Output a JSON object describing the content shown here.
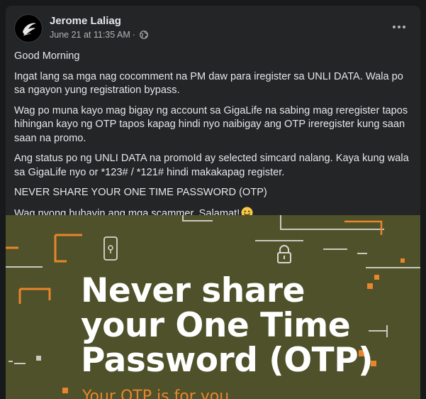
{
  "post": {
    "author": "Jerome Laliag",
    "timestamp": "June 21 at 11:35 AM",
    "separator": "·",
    "privacy_icon": "globe-icon",
    "more_icon": "more-dots-icon",
    "paragraphs": [
      "Good Morning",
      "Ingat lang sa mga nag cocomment na PM daw para iregister sa UNLI DATA. Wala po sa ngayon yung registration bypass.",
      "Wag po muna kayo mag bigay ng account sa GigaLife na sabing mag reregister tapos hihingan kayo ng OTP tapos kapag hindi nyo naibigay ang OTP ireregister kung saan saan na promo.",
      "Ang status po ng UNLI DATA na promoId ay selected simcard nalang. Kaya kung wala sa GigaLife nyo or *123# / *121# hindi makakapag register.",
      "NEVER SHARE YOUR ONE TIME PASSWORD (OTP)",
      "Wag nyong buhayin ang mga scammer. Salamat!"
    ],
    "closing_emoji": "smiling-face-emoji"
  },
  "image": {
    "headline_lines": [
      "Never share",
      "your One Time",
      "Password (OTP)"
    ],
    "subline": "Your OTP is for you",
    "colors": {
      "background": "#4e5129",
      "accent": "#e8852d",
      "line": "#c9c9c0"
    }
  }
}
